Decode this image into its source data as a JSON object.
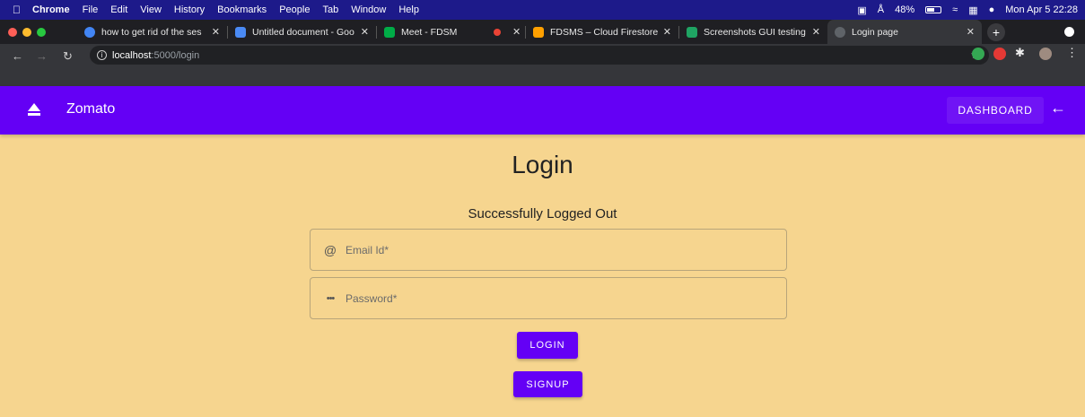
{
  "menubar": {
    "app": "Chrome",
    "items": [
      "File",
      "Edit",
      "View",
      "History",
      "Bookmarks",
      "People",
      "Tab",
      "Window",
      "Help"
    ],
    "battery": "48%",
    "datetime": "Mon Apr 5  22:28"
  },
  "tabs": [
    {
      "title": "how to get rid of the ses",
      "fav_color": "#4285f4"
    },
    {
      "title": "Untitled document - Goo",
      "fav_color": "#4a8af4"
    },
    {
      "title": "Meet - FDSM",
      "fav_color": "#00ac47"
    },
    {
      "title": "",
      "fav_color": "#ea4335"
    },
    {
      "title": "FDSMS – Cloud Firestore",
      "fav_color": "#ffa000"
    },
    {
      "title": "Screenshots GUI testing",
      "fav_color": "#1fa463"
    },
    {
      "title": "Login page",
      "fav_color": "#5f6368"
    }
  ],
  "address": {
    "host": "localhost",
    "path": ":5000/login"
  },
  "appbar": {
    "brand": "Zomato",
    "dashboard_label": "DASHBOARD"
  },
  "main": {
    "title": "Login",
    "status": "Successfully Logged Out",
    "email_placeholder": "Email Id*",
    "password_placeholder": "Password*",
    "login_label": "LOGIN",
    "signup_label": "SIGNUP"
  },
  "colors": {
    "accent": "#6400f5",
    "background": "#f6d58f"
  }
}
